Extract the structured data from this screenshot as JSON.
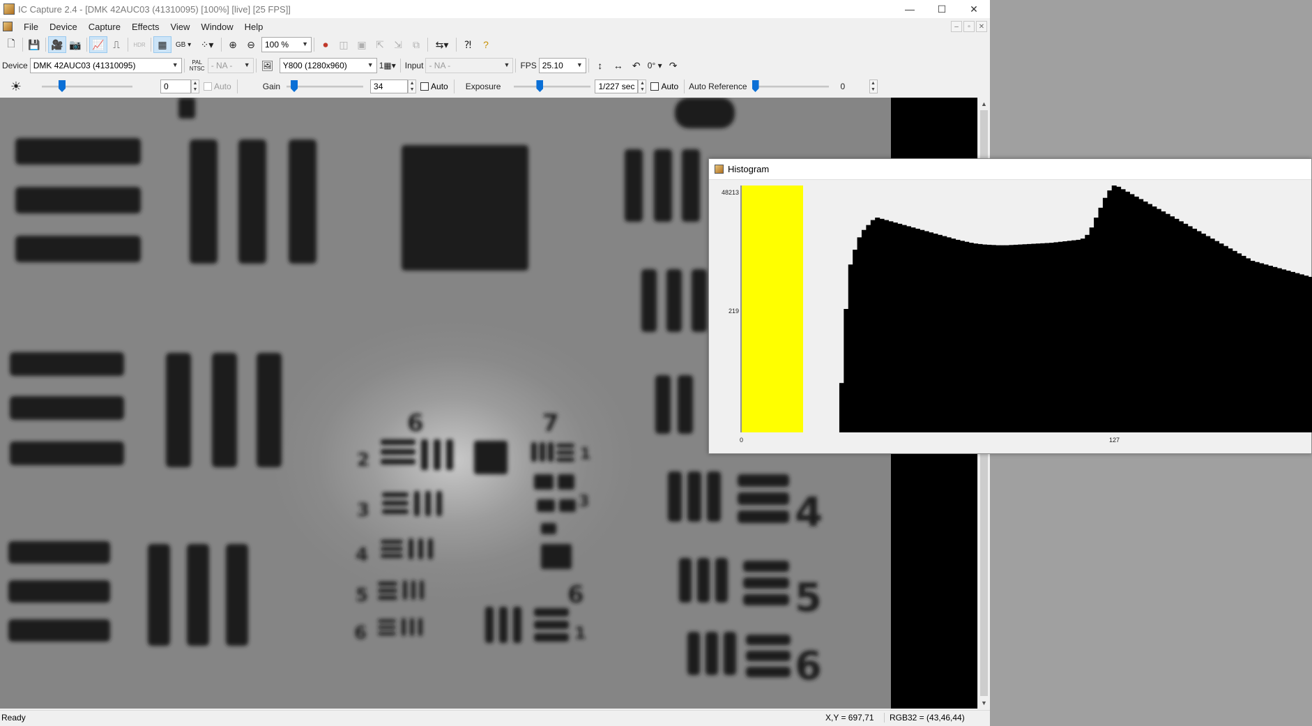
{
  "window": {
    "title": "IC Capture 2.4 - [DMK 42AUC03 (41310095) [100%]  [live]  [25 FPS]]",
    "controls": [
      "—",
      "☐",
      "✕"
    ]
  },
  "menu": {
    "items": [
      "File",
      "Device",
      "Capture",
      "Effects",
      "View",
      "Window",
      "Help"
    ],
    "mdi_controls": [
      "–",
      "▫",
      "✕"
    ]
  },
  "toolbar": {
    "zoom_value": "100 %",
    "color_label": "GB",
    "hdr_label": "HDR"
  },
  "devicebar": {
    "device_label": "Device",
    "device_value": "DMK 42AUC03 (41310095)",
    "pal_ntsc_label": "PAL NTSC",
    "video_norm_value": "- NA -",
    "format_value": "Y800 (1280x960)",
    "binning_value": "1",
    "input_label": "Input",
    "input_value": "- NA -",
    "fps_label": "FPS",
    "fps_value": "25.10",
    "rotation_value": "0°"
  },
  "properties": {
    "brightness_value": "0",
    "brightness_level": 0.2,
    "brightness_auto_label": "Auto",
    "gain_label": "Gain",
    "gain_value": "34",
    "gain_level": 0.06,
    "gain_auto_label": "Auto",
    "exposure_label": "Exposure",
    "exposure_value": "1/227 sec",
    "exposure_level": 0.32,
    "exposure_auto_label": "Auto",
    "auto_reference_label": "Auto Reference",
    "auto_reference_value": "0",
    "auto_reference_level": 0.0
  },
  "statusbar": {
    "status": "Ready",
    "coordinates": "X,Y = 697,71",
    "pixel_value": "RGB32 = (43,46,44)"
  },
  "histogram": {
    "title": "Histogram",
    "y_max_label": "48213",
    "y_mid_label": "219",
    "x_min_label": "0",
    "x_mid_label": "127",
    "highlight_color": "#ffff00",
    "bar_color": "#000000",
    "background_color": "#f0f0f0",
    "profile": [
      0.0,
      0.0,
      0.0,
      0.0,
      0.0,
      0.0,
      0.0,
      0.0,
      0.0,
      0.0,
      0.0,
      0.0,
      0.0,
      0.0,
      0.0,
      0.0,
      0.0,
      0.0,
      0.0,
      0.0,
      0.0,
      0.0,
      0.2,
      0.5,
      0.68,
      0.74,
      0.79,
      0.82,
      0.84,
      0.86,
      0.87,
      0.865,
      0.86,
      0.855,
      0.85,
      0.845,
      0.84,
      0.835,
      0.83,
      0.825,
      0.82,
      0.815,
      0.81,
      0.805,
      0.8,
      0.795,
      0.79,
      0.785,
      0.78,
      0.776,
      0.772,
      0.768,
      0.765,
      0.763,
      0.761,
      0.76,
      0.759,
      0.758,
      0.758,
      0.758,
      0.759,
      0.76,
      0.761,
      0.762,
      0.763,
      0.764,
      0.765,
      0.766,
      0.767,
      0.768,
      0.77,
      0.772,
      0.774,
      0.776,
      0.778,
      0.78,
      0.785,
      0.8,
      0.83,
      0.87,
      0.91,
      0.95,
      0.98,
      1.0,
      0.995,
      0.985,
      0.975,
      0.965,
      0.955,
      0.945,
      0.935,
      0.925,
      0.915,
      0.905,
      0.895,
      0.885,
      0.875,
      0.865,
      0.855,
      0.845,
      0.835,
      0.825,
      0.815,
      0.805,
      0.795,
      0.785,
      0.775,
      0.765,
      0.755,
      0.745,
      0.735,
      0.725,
      0.715,
      0.705,
      0.695,
      0.69,
      0.685,
      0.68,
      0.675,
      0.67,
      0.665,
      0.66,
      0.655,
      0.65,
      0.645,
      0.64,
      0.635,
      0.63
    ]
  },
  "scroll": {
    "up": "▲",
    "down": "▼"
  }
}
